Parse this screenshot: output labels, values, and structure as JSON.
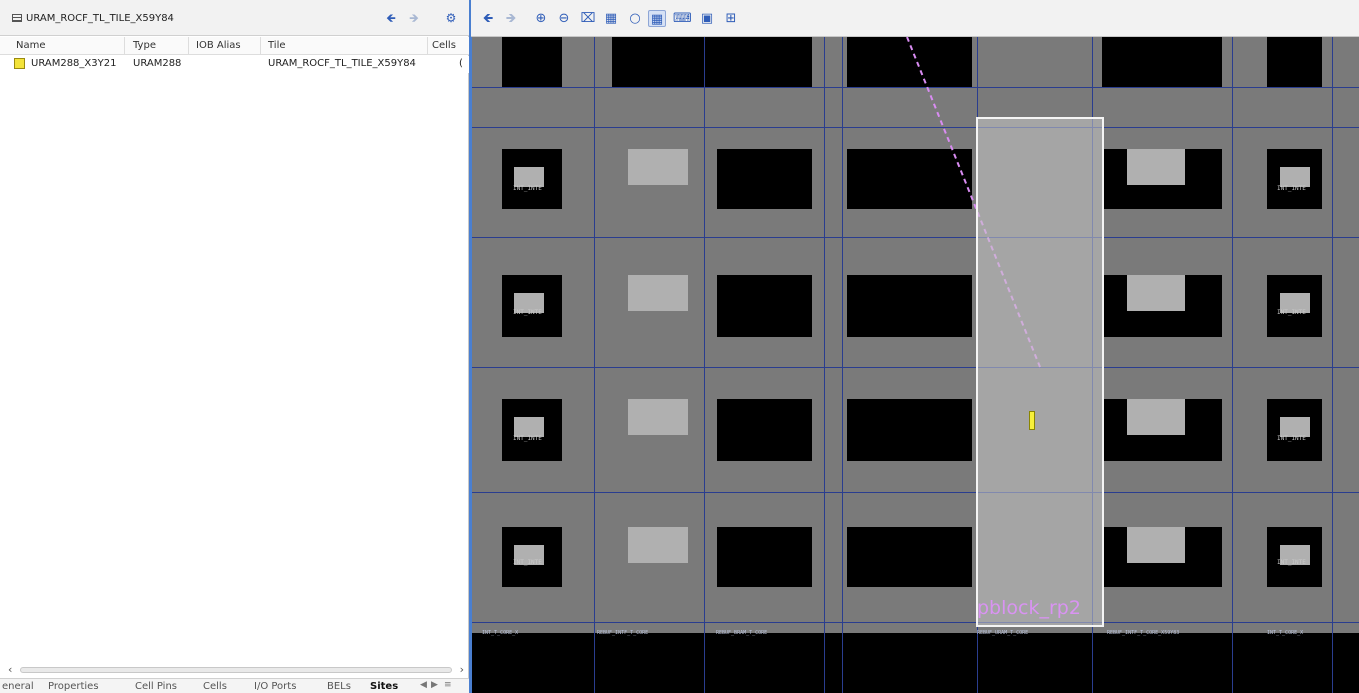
{
  "left_panel": {
    "title": "URAM_ROCF_TL_TILE_X59Y84",
    "back_icon": "arrow-left-icon",
    "forward_icon": "arrow-right-icon",
    "settings_icon": "gear-icon",
    "columns": [
      "Name",
      "Type",
      "IOB Alias",
      "Tile",
      "Cells"
    ],
    "rows": [
      {
        "name": "URAM288_X3Y21",
        "type": "URAM288",
        "iob_alias": "",
        "tile": "URAM_ROCF_TL_TILE_X59Y84",
        "cells": "("
      }
    ],
    "tabs": [
      "eneral",
      "Properties",
      "Cell Pins",
      "Cells",
      "I/O Ports",
      "BELs",
      "Sites"
    ],
    "active_tab": "Sites"
  },
  "device_view": {
    "toolbar_icons": [
      "back-icon",
      "forward-icon",
      "zoom-in-icon",
      "zoom-out-icon",
      "zoom-fit-icon",
      "zoom-selection-icon",
      "refresh-icon",
      "routing-resources-icon",
      "pblock-icon",
      "cell-icon",
      "connections-icon"
    ],
    "pblock_label": "pblock_rp2",
    "tile_label": "INT_INTE",
    "bottom_labels": [
      "INT_T_CORE_X",
      "REBUF_INTF_T_CORE",
      "REBUF_BRAM_T_CORE",
      "REBUF_URAM_T_CORE",
      "REBUF_INTF_T_CORE_X59Y83",
      "INT_T_CORE_X"
    ],
    "colors": {
      "pblock_label": "#d993f2",
      "net_line": "#d98cf2",
      "highlight": "#f7f03a",
      "background": "#7a7a7a"
    }
  }
}
